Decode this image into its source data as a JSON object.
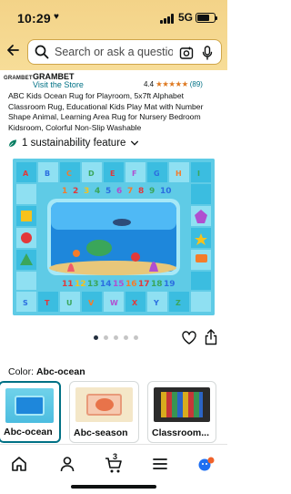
{
  "status_bar": {
    "time": "10:29",
    "network": "5G"
  },
  "search": {
    "placeholder": "Search or ask a question"
  },
  "brand": {
    "logo_text": "GRAMBET",
    "name": "GRAMBET",
    "store_link": "Visit the Store"
  },
  "rating": {
    "value": "4.4",
    "stars": "★★★★★",
    "star_fraction": 0.88,
    "count": "(89)"
  },
  "product_title": "ABC Kids Ocean Rug for Playroom, 5x7ft Alphabet Classroom Rug, Educational Kids Play Mat with Number Shape Animal, Learning Area Rug for Nursery Bedroom Kidsroom, Colorful Non-Slip Washable",
  "sustainability": {
    "label": "1 sustainability feature",
    "chevron": "chevron-down-icon"
  },
  "image_carousel": {
    "dots": 5,
    "active_index": 0
  },
  "color": {
    "label": "Color:",
    "value": "Abc-ocean"
  },
  "variants": [
    {
      "label": "Abc-ocean",
      "selected": true
    },
    {
      "label": "Abc-season",
      "selected": false
    },
    {
      "label": "Classroom...",
      "selected": false
    }
  ],
  "bottom_nav": {
    "items": [
      "home-icon",
      "account-icon",
      "cart-icon",
      "menu-icon",
      "ai-assistant-icon"
    ],
    "cart_count": "3"
  },
  "colors": {
    "accent_link": "#007185",
    "star": "#de7921",
    "header": "#f3d388",
    "selected_border": "#007185"
  }
}
